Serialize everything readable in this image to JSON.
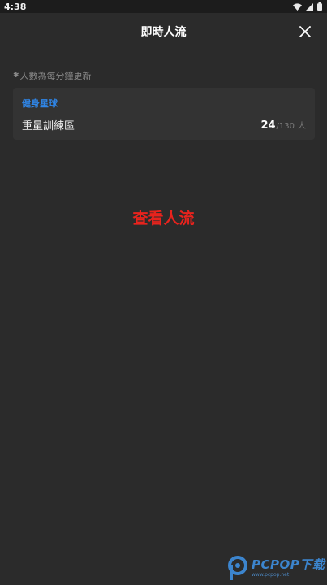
{
  "status_bar": {
    "time": "4:38",
    "icons": [
      "wifi-icon",
      "signal-icon",
      "battery-icon"
    ]
  },
  "header": {
    "title": "即時人流",
    "close_icon": "close-icon"
  },
  "note": {
    "mark": "✱",
    "text": "人數為每分鐘更新"
  },
  "card": {
    "gym_name": "健身星球",
    "areas": [
      {
        "name": "重量訓練區",
        "current": "24",
        "separator": "/",
        "total": "130",
        "unit": "人"
      }
    ]
  },
  "overlay_caption": "查看人流",
  "watermark": {
    "main": "PCPOP下载",
    "sub": "www.pcpop.net"
  },
  "colors": {
    "background": "#2b2b2b",
    "card": "#333333",
    "accent_blue": "#2f86e8",
    "caption_red": "#e8231d"
  }
}
